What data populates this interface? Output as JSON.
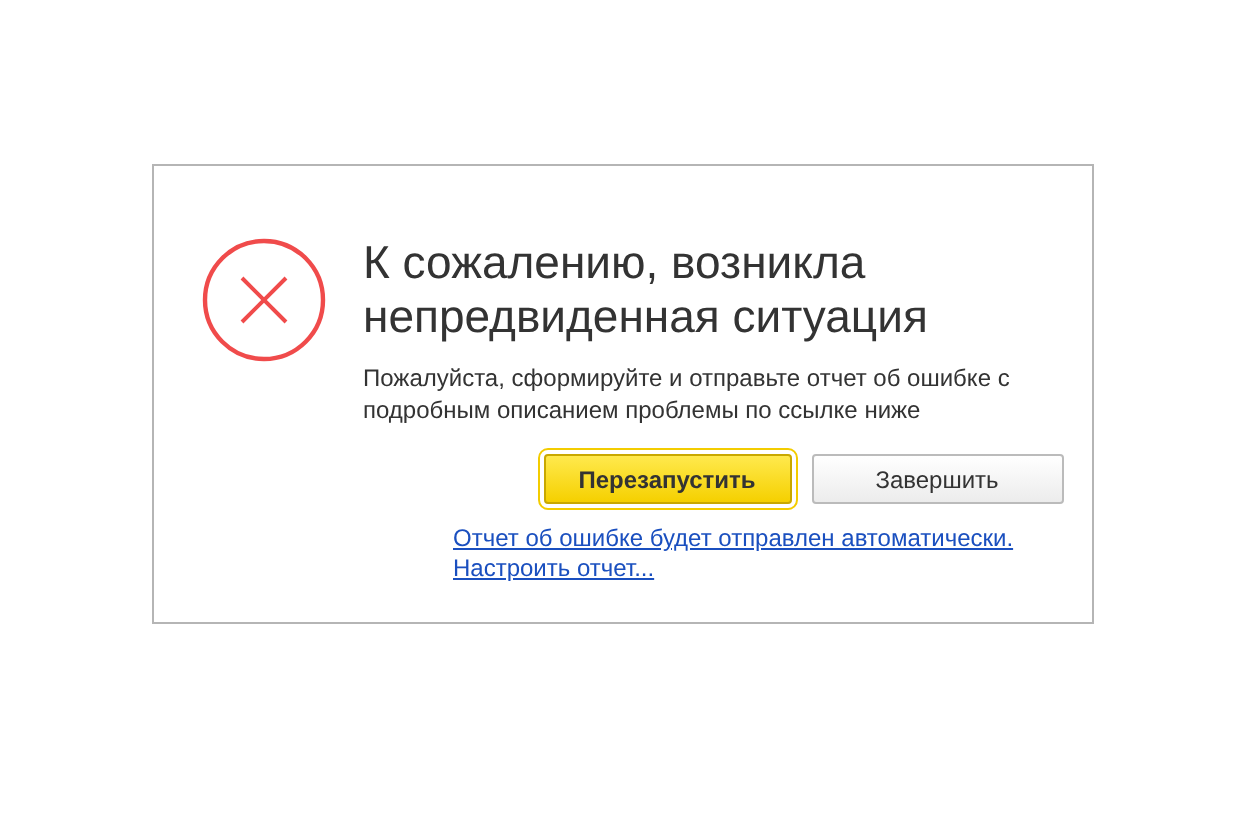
{
  "dialog": {
    "title": "К сожалению, возникла непредвиденная ситуация",
    "message": "Пожалуйста, сформируйте и отправьте отчет об ошибке с подробным описанием проблемы по ссылке ниже",
    "buttons": [
      {
        "label": "Перезапустить",
        "kind": "primary"
      },
      {
        "label": "Завершить",
        "kind": "secondary"
      }
    ],
    "links": [
      "Отчет об ошибке будет отправлен автоматически.",
      "Настроить отчет..."
    ]
  }
}
